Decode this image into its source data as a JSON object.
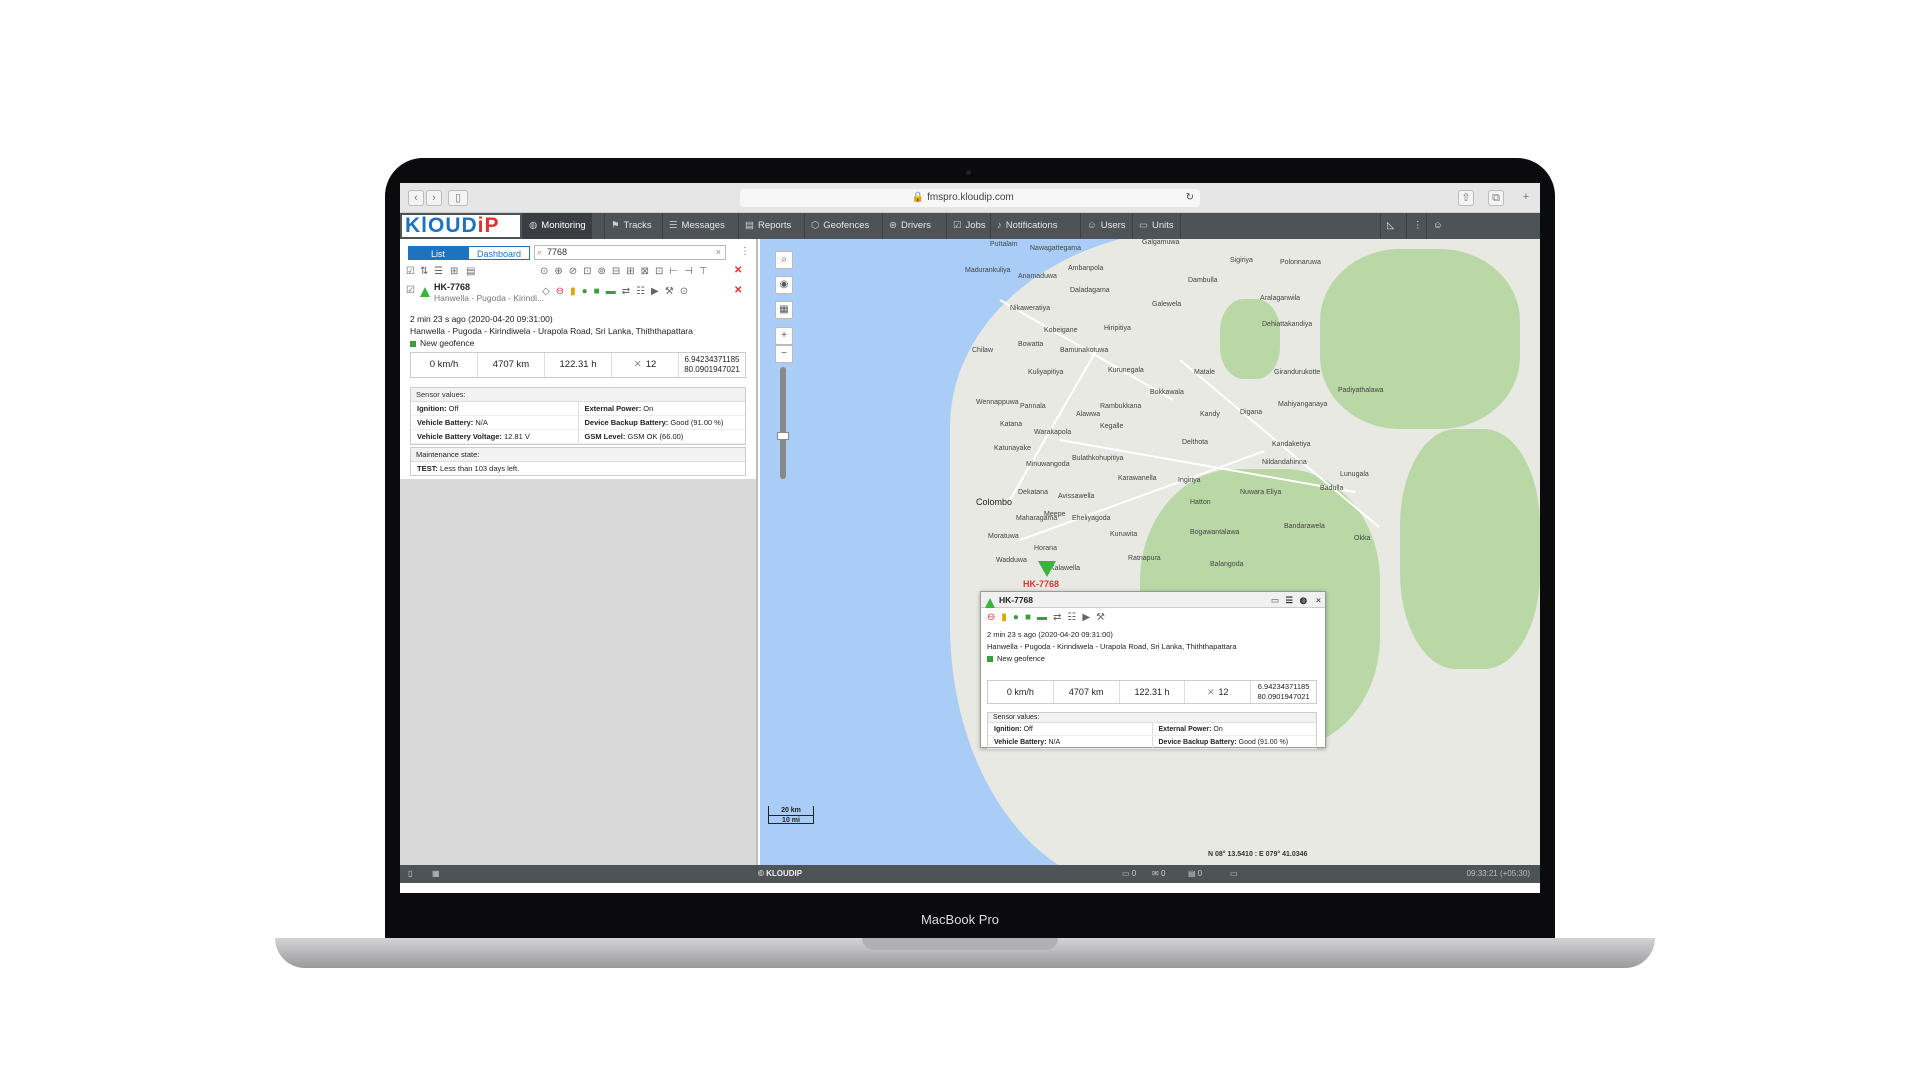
{
  "browser": {
    "url": "fmspro.kloudip.com"
  },
  "logo": {
    "main": "KlOUD",
    "accent": "iP"
  },
  "nav": [
    {
      "label": "Monitoring",
      "icon": "globe-icon"
    },
    {
      "label": "Tracks",
      "icon": "flag-icon"
    },
    {
      "label": "Messages",
      "icon": "list-icon"
    },
    {
      "label": "Reports",
      "icon": "report-icon"
    },
    {
      "label": "Geofences",
      "icon": "geofence-icon"
    },
    {
      "label": "Drivers",
      "icon": "steering-icon"
    },
    {
      "label": "Jobs",
      "icon": "check-icon"
    },
    {
      "label": "Notifications",
      "icon": "bell-icon"
    },
    {
      "label": "Users",
      "icon": "user-icon"
    },
    {
      "label": "Units",
      "icon": "car-icon"
    }
  ],
  "left": {
    "tab_list": "List",
    "tab_dashboard": "Dashboard",
    "search_value": "7768",
    "unit_name": "HK-7768",
    "unit_address": "Hanwella - Pugoda - Kirindi...",
    "time": "2 min 23 s ago (2020-04-20 09:31:00)",
    "address": "Hanwella - Pugoda - Kirindiwela - Urapola Road, Sri Lanka, Thiththapattara",
    "geofence": "New geofence",
    "speed": "0 km/h",
    "mileage": "4707 km",
    "engine_hours": "122.31 h",
    "satellites": "12",
    "lat": "6.94234371185",
    "lon": "80.0901947021",
    "sensor_header": "Sensor values:",
    "sensors": [
      {
        "k1": "Ignition:",
        "v1": "Off",
        "k2": "External Power:",
        "v2": "On"
      },
      {
        "k1": "Vehicle Battery:",
        "v1": "N/A",
        "k2": "Device Backup Battery:",
        "v2": "Good (91.00 %)"
      },
      {
        "k1": "Vehicle Battery Voltage:",
        "v1": "12.81 V",
        "k2": "GSM Level:",
        "v2": "GSM OK (66.00)"
      }
    ],
    "maint_header": "Maintenance state:",
    "maint_key": "TEST:",
    "maint_value": "Less than 103 days left."
  },
  "map": {
    "marker_label": "HK-7768",
    "scale_km": "20 km",
    "scale_mi": "10 mi",
    "coords": "N 08° 13.5410 : E 079° 41.0346",
    "towns": [
      "Puttalam",
      "Nawagattegama",
      "Galgamuwa",
      "Sigiriya",
      "Polonnaruwa",
      "Madurankuliya",
      "Anamaduwa",
      "Ambanpola",
      "Dambulla",
      "Daladagama",
      "Galewela",
      "Aralaganwila",
      "Nikaweratiya",
      "Kobeigane",
      "Hiripitiya",
      "Dehiattakandiya",
      "Chilaw",
      "Bowatta",
      "Bamunakotuwa",
      "Kuliyapitiya",
      "Kurunegala",
      "Matale",
      "Girandurukotte",
      "Padiyathalawa",
      "Wennappuwa",
      "Bokkawala",
      "Pannala",
      "Rambukkana",
      "Kandy",
      "Mahiyanganaya",
      "Alawwa",
      "Digana",
      "Katana",
      "Kegalle",
      "Warakapola",
      "Delthota",
      "Kandaketiya",
      "Katunayake",
      "Bulathkohupitiya",
      "Minuwangoda",
      "Nildandahinna",
      "Karawanella",
      "Badulla",
      "Lunugala",
      "Ingiriya",
      "Nuwara Eliya",
      "Dekatana",
      "Avissawella",
      "Colombo",
      "Hatton",
      "Maharagama",
      "Meepe",
      "Eheliyagoda",
      "Bandarawela",
      "Moratuwa",
      "Kuruwita",
      "Bogawantalawa",
      "Horana",
      "Ratnapura",
      "Balangoda",
      "Wadduwa",
      "Kalawella",
      "Okka"
    ]
  },
  "popup": {
    "title": "HK-7768",
    "time": "2 min 23 s ago (2020-04-20 09:31:00)",
    "address": "Hanwella - Pugoda - Kirindiwela - Urapola Road, Sri Lanka, Thiththapattara",
    "geofence": "New geofence",
    "speed": "0 km/h",
    "mileage": "4707 km",
    "engine_hours": "122.31 h",
    "satellites": "12",
    "lat": "6.94234371185",
    "lon": "80.0901947021",
    "sensor_header": "Sensor values:",
    "sensors": [
      {
        "k1": "Ignition:",
        "v1": "Off",
        "k2": "External Power:",
        "v2": "On"
      },
      {
        "k1": "Vehicle Battery:",
        "v1": "N/A",
        "k2": "Device Backup Battery:",
        "v2": "Good (91.00 %)"
      }
    ]
  },
  "bottom": {
    "copyright": "© KLOUDIP",
    "clock": "09:33:21 (+05:30)",
    "c1": "0",
    "c2": "0",
    "c3": "0"
  },
  "device": {
    "name": "MacBook Pro"
  },
  "colors": {
    "nav": "#4e5358",
    "accent": "#1e73be",
    "unit_green": "#3cb33c",
    "alert": "#d33333",
    "water": "#a9cdf6"
  }
}
